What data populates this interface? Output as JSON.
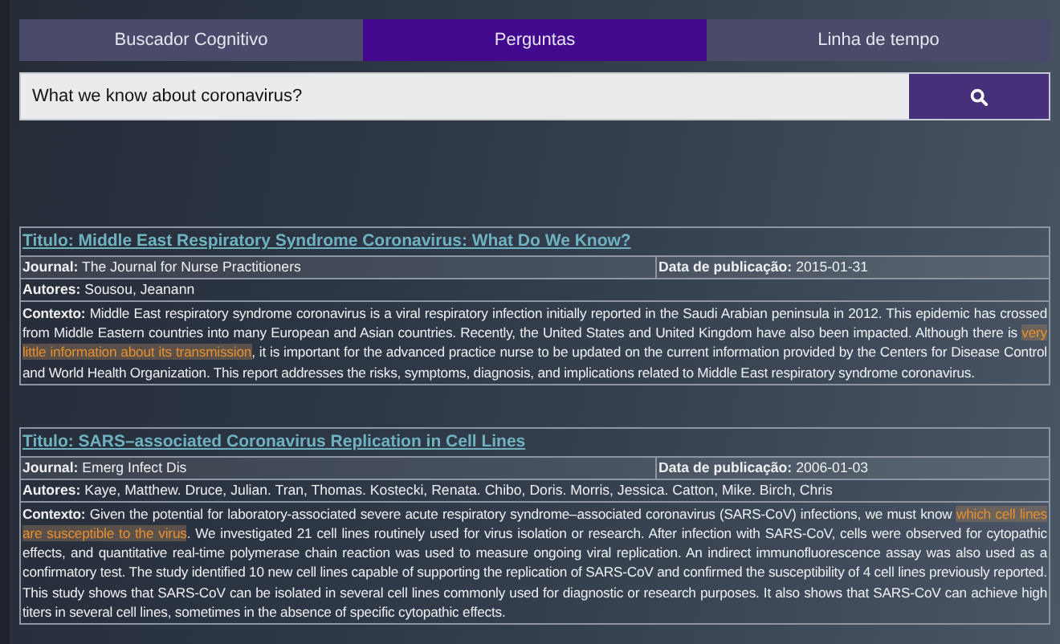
{
  "tabs": [
    {
      "label": "Buscador Cognitivo",
      "selected": false
    },
    {
      "label": "Perguntas",
      "selected": true
    },
    {
      "label": "Linha de tempo",
      "selected": false
    }
  ],
  "search": {
    "value": "What we know about coronavirus?"
  },
  "results": [
    {
      "title": "Titulo: Middle East Respiratory Syndrome Coronavirus: What Do We Know?",
      "journal_label": "Journal:",
      "journal": "The Journal for Nurse Practitioners",
      "date_label": "Data de publicação:",
      "date": "2015-01-31",
      "authors_label": "Autores:",
      "authors": "Sousou, Jeanann",
      "context_label": "Contexto:",
      "context": [
        {
          "text": " Middle East respiratory syndrome coronavirus is a viral respiratory infection initially reported in the Saudi Arabian peninsula in 2012. This epidemic has crossed from Middle Eastern countries into many European and Asian countries. Recently, the United States and United Kingdom have also been impacted. Although there is ",
          "highlighted": false
        },
        {
          "text": "very little information about its transmission",
          "highlighted": true
        },
        {
          "text": ", it is important for the advanced practice nurse to be updated on the current information provided by the Centers for Disease Control and World Health Organization. This report addresses the risks, symptoms, diagnosis, and implications related to Middle East respiratory syndrome coronavirus.",
          "highlighted": false
        }
      ]
    },
    {
      "title": "Titulo: SARS–associated Coronavirus Replication in Cell Lines",
      "journal_label": "Journal:",
      "journal": "Emerg Infect Dis",
      "date_label": "Data de publicação:",
      "date": "2006-01-03",
      "authors_label": "Autores:",
      "authors": "Kaye, Matthew. Druce, Julian. Tran, Thomas. Kostecki, Renata. Chibo, Doris. Morris, Jessica. Catton, Mike. Birch, Chris",
      "context_label": "Contexto:",
      "context": [
        {
          "text": " Given the potential for laboratory-associated severe acute respiratory syndrome–associated coronavirus (SARS-CoV) infections, we must know ",
          "highlighted": false
        },
        {
          "text": "which cell lines are susceptible to the virus",
          "highlighted": true
        },
        {
          "text": ". We investigated 21 cell lines routinely used for virus isolation or research. After infection with SARS-CoV, cells were observed for cytopathic effects, and quantitative real-time polymerase chain reaction was used to measure ongoing viral replication. An indirect immunofluorescence assay was also used as a confirmatory test. The study identified 10 new cell lines capable of supporting the replication of SARS-CoV and confirmed the susceptibility of 4 cell lines previously reported. This study shows that SARS-CoV can be isolated in several cell lines commonly used for diagnostic or research purposes. It also shows that SARS-CoV can achieve high titers in several cell lines, sometimes in the absence of specific cytopathic effects.",
          "highlighted": false
        }
      ]
    }
  ]
}
